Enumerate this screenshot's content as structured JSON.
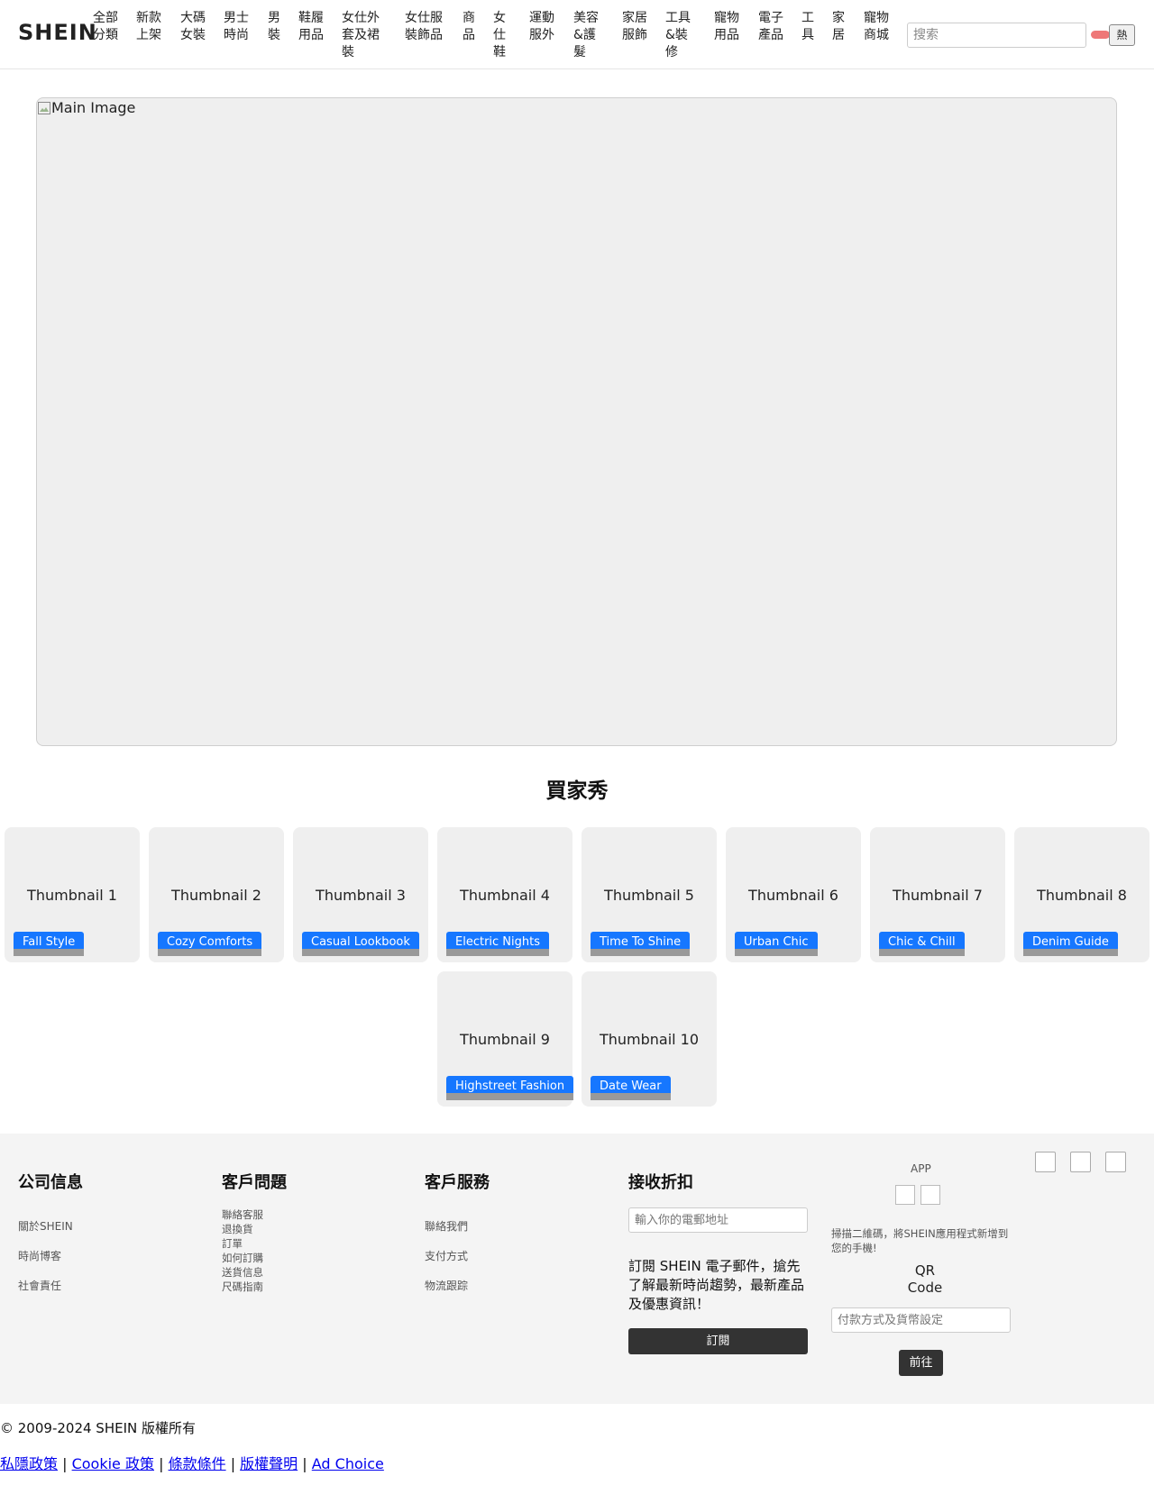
{
  "header": {
    "logo": "SHEIN",
    "nav": [
      "全部\n分類",
      "新款\n上架",
      "大碼\n女裝",
      "男士\n時尚",
      "男\n裝",
      "鞋履\n用品",
      "女仕外\n套及裙\n裝",
      "女仕服\n裝飾品",
      "商\n品",
      "女\n仕\n鞋",
      "運動\n服外",
      "美容\n&護\n髮",
      "家居\n服飾",
      "工具\n&裝\n修",
      "寵物\n用品",
      "電子\n產品",
      "工\n具",
      "家\n居",
      "寵物\n商城"
    ],
    "search_placeholder": "搜索",
    "hot_button": "熱"
  },
  "main_image": {
    "alt": "Main Image"
  },
  "buyer_show": {
    "title": "買家秀",
    "items": [
      {
        "alt": "Thumbnail 1",
        "tag": "Fall Style"
      },
      {
        "alt": "Thumbnail 2",
        "tag": "Cozy Comforts"
      },
      {
        "alt": "Thumbnail 3",
        "tag": "Casual Lookbook"
      },
      {
        "alt": "Thumbnail 4",
        "tag": "Electric Nights"
      },
      {
        "alt": "Thumbnail 5",
        "tag": "Time To Shine"
      },
      {
        "alt": "Thumbnail 6",
        "tag": "Urban Chic"
      },
      {
        "alt": "Thumbnail 7",
        "tag": "Chic & Chill"
      },
      {
        "alt": "Thumbnail 8",
        "tag": "Denim Guide"
      },
      {
        "alt": "Thumbnail 9",
        "tag": "Highstreet Fashion"
      },
      {
        "alt": "Thumbnail 10",
        "tag": "Date Wear"
      }
    ]
  },
  "footer": {
    "company": {
      "title": "公司信息",
      "links": [
        "關於SHEIN",
        "時尚博客",
        "社會責任"
      ]
    },
    "customer_issues": {
      "title": "客戶問題",
      "links": [
        "聯絡客服",
        "退換貨",
        "訂單",
        "如何訂購",
        "送貨信息",
        "尺碼指南"
      ]
    },
    "customer_service": {
      "title": "客戶服務",
      "links": [
        "聯絡我們",
        "支付方式",
        "物流跟踪"
      ]
    },
    "discount": {
      "title": "接收折扣",
      "email_placeholder": "輸入你的電郵地址",
      "text": "訂閱 SHEIN 電子郵件，搶先了解最新時尚趨勢，最新產品及優惠資訊！",
      "subscribe": "訂閱"
    },
    "app": {
      "label": "APP",
      "qr_note": "掃描二維碼，將SHEIN應用程式新增到您的手機!",
      "qr_alt": "QR Code",
      "payment_placeholder": "付款方式及貨幣設定",
      "go": "前往"
    }
  },
  "bottom": {
    "copyright": "© 2009-2024 SHEIN 版權所有",
    "links": [
      "私隱政策",
      "Cookie 政策",
      "條款條件",
      "版權聲明",
      "Ad Choice"
    ],
    "separator": "|"
  },
  "colors": {
    "tag_blue": "#1677ff",
    "dark_button": "#333333",
    "hot_pill": "#ee7777"
  }
}
